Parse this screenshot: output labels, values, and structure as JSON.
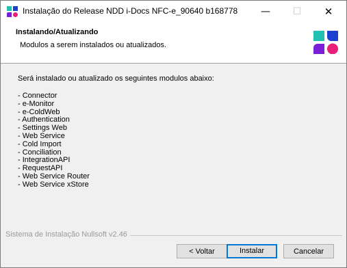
{
  "window": {
    "title": "Instalação do Release NDD i-Docs NFC-e_90640 b168778"
  },
  "titlebar": {
    "minimize": "—",
    "maximize": "☐",
    "close": "✕"
  },
  "header": {
    "title": "Instalando/Atualizando",
    "subtitle": "Modulos a serem instalados ou atualizados.",
    "logo_colors": [
      "#21c0b0",
      "#1d3fcf",
      "#7b1fd6",
      "#e8207a"
    ]
  },
  "content": {
    "intro": "Será instalado ou atualizado os seguintes modulos abaixo:",
    "modules": [
      "- Connector",
      "- e-Monitor",
      "- e-ColdWeb",
      "- Authentication",
      "- Settings Web",
      "- Web Service",
      "- Cold Import",
      "- Conciliation",
      "- IntegrationAPI",
      "- RequestAPI",
      "- Web Service Router",
      "- Web Service xStore"
    ]
  },
  "footer": {
    "brand": "Sistema de Instalação Nullsoft v2.46",
    "back_label": "< Voltar",
    "install_label": "Instalar",
    "cancel_label": "Cancelar"
  }
}
